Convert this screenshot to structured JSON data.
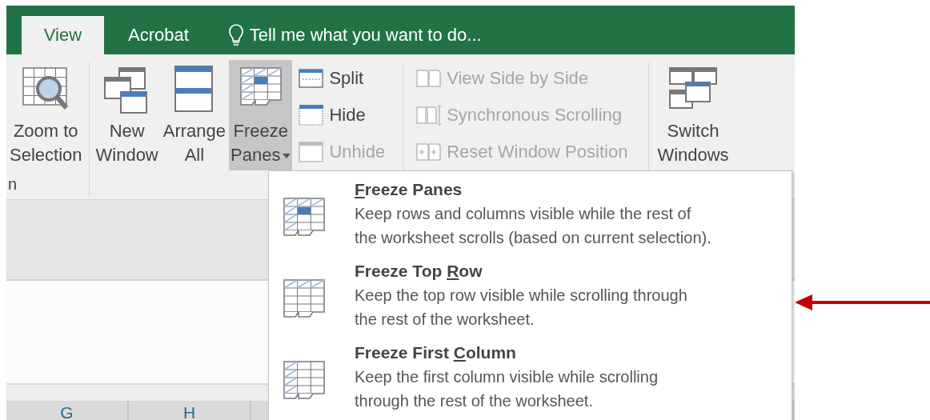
{
  "tabs": [
    {
      "label": "View",
      "selected": true
    },
    {
      "label": "Acrobat",
      "selected": false
    }
  ],
  "tell_me": {
    "placeholder": "Tell me what you want to do..."
  },
  "ribbon": {
    "window_buttons": [
      {
        "kind": "button",
        "label_lines": [
          "Zoom to",
          "Selection"
        ],
        "expanded": false
      },
      {
        "kind": "button",
        "label_lines": [
          "New",
          "Window"
        ],
        "expanded": false
      },
      {
        "kind": "button",
        "label_lines": [
          "Arrange",
          "All"
        ],
        "expanded": false
      },
      {
        "kind": "dropdown",
        "label_lines": [
          "Freeze",
          "Panes"
        ],
        "expanded": true
      }
    ],
    "pane_commands": [
      {
        "label": "Split",
        "disabled": false
      },
      {
        "label": "Hide",
        "disabled": false
      },
      {
        "label": "Unhide",
        "disabled": true
      }
    ],
    "compare_commands": [
      {
        "label": "View Side by Side",
        "disabled": true
      },
      {
        "label": "Synchronous Scrolling",
        "disabled": true
      },
      {
        "label": "Reset Window Position",
        "disabled": true
      }
    ],
    "switch_button": {
      "label_lines": [
        "Switch",
        "Windows"
      ]
    },
    "group_label": "n"
  },
  "freeze_menu": {
    "items": [
      {
        "title": {
          "key": "F",
          "after": "reeze Panes"
        },
        "description_lines": [
          "Keep rows and columns visible while the rest of",
          "the worksheet scrolls (based on current selection)."
        ]
      },
      {
        "title": {
          "before": "Freeze Top ",
          "key": "R",
          "after": "ow"
        },
        "description_lines": [
          "Keep the top row visible while scrolling through",
          "the rest of the worksheet."
        ]
      },
      {
        "title": {
          "before": "Freeze First ",
          "key": "C",
          "after": "olumn"
        },
        "description_lines": [
          "Keep the first column visible while scrolling",
          "through the rest of the worksheet."
        ]
      }
    ]
  },
  "column_headers": [
    "G",
    "H"
  ],
  "annotation": {
    "kind": "arrow"
  }
}
